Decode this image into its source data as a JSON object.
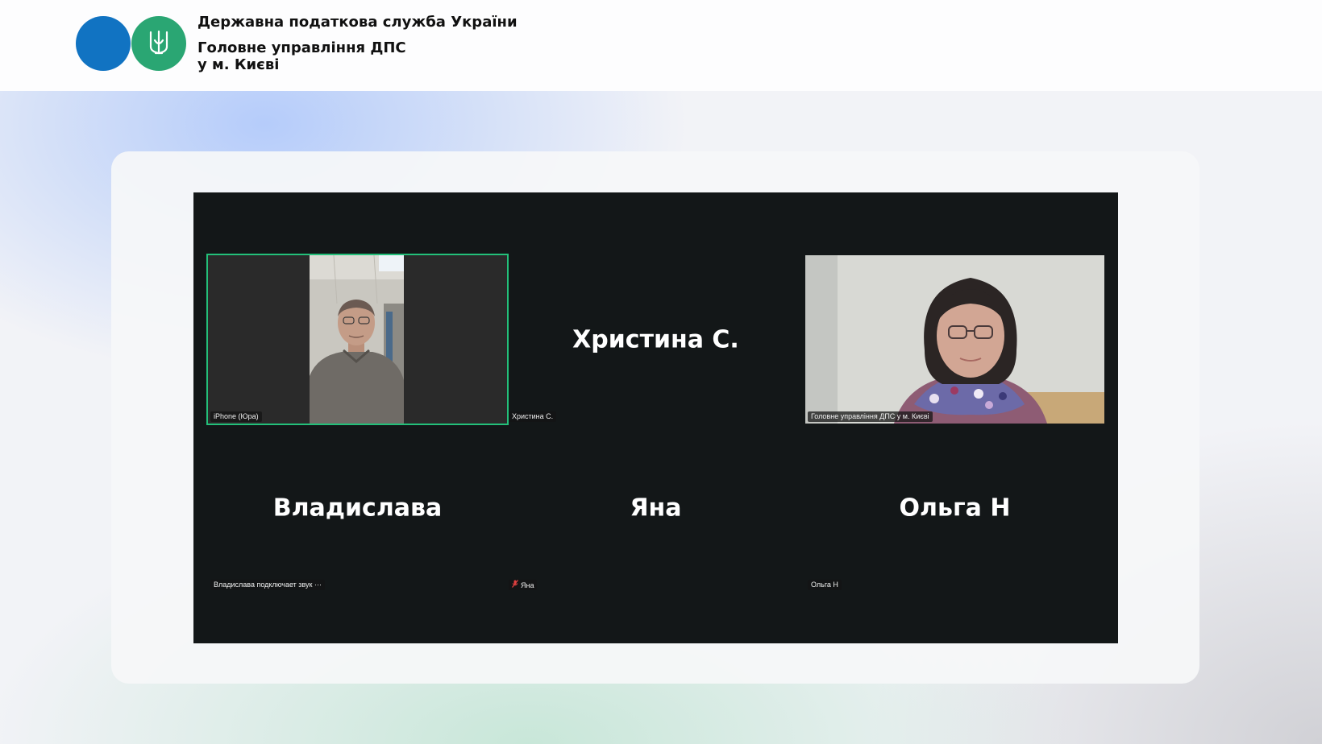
{
  "header": {
    "org_name": "Державна податкова служба України",
    "office_line1": "Головне управління ДПС",
    "office_line2": "у м. Києві",
    "colors": {
      "blue": "#1173c2",
      "green": "#2aa673"
    }
  },
  "meeting": {
    "background": "#131718",
    "active_speaker_color": "#23c07a",
    "tiles": [
      {
        "id": "yura",
        "display_name": "",
        "label": "iPhone (Юра)",
        "video": true,
        "active": true
      },
      {
        "id": "khrystyna",
        "display_name": "Христина С.",
        "label": "Христина С.",
        "video": false
      },
      {
        "id": "gu-dps",
        "display_name": "",
        "label": "Головне управління ДПС у м. Києві",
        "video": true
      },
      {
        "id": "vladyslava",
        "display_name": "Владислава",
        "label": "Владислава подключает звук",
        "video": false,
        "status_icon": "ellipsis-icon"
      },
      {
        "id": "yana",
        "display_name": "Яна",
        "label": "Яна",
        "video": false,
        "muted": true,
        "status_icon": "muted-mic-icon"
      },
      {
        "id": "olga",
        "display_name": "Ольга Н",
        "label": "Ольга Н",
        "video": false
      }
    ]
  }
}
